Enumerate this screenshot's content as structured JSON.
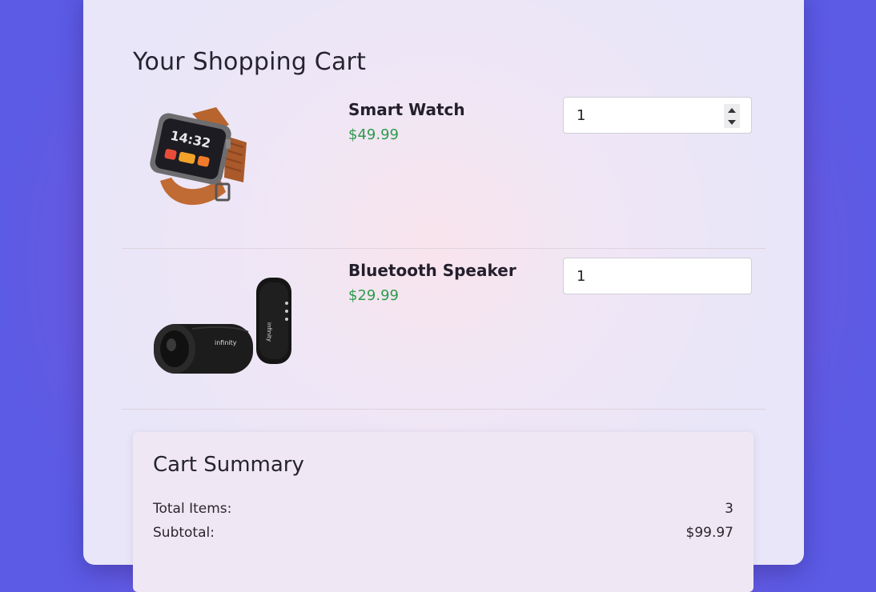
{
  "page": {
    "title": "Your Shopping Cart"
  },
  "cart": {
    "items": [
      {
        "name": "Smart Watch",
        "price": "$49.99",
        "quantity": "1",
        "image_icon": "smart-watch-image"
      },
      {
        "name": "Bluetooth Speaker",
        "price": "$29.99",
        "quantity": "1",
        "image_icon": "bluetooth-speaker-image"
      }
    ]
  },
  "summary": {
    "title": "Cart Summary",
    "total_items_label": "Total Items:",
    "total_items_value": "3",
    "subtotal_label": "Subtotal:",
    "subtotal_value": "$99.97"
  },
  "colors": {
    "price_green": "#2e9b4c",
    "background_purple": "#5b5be6",
    "card_background": "#f0e6f5"
  }
}
